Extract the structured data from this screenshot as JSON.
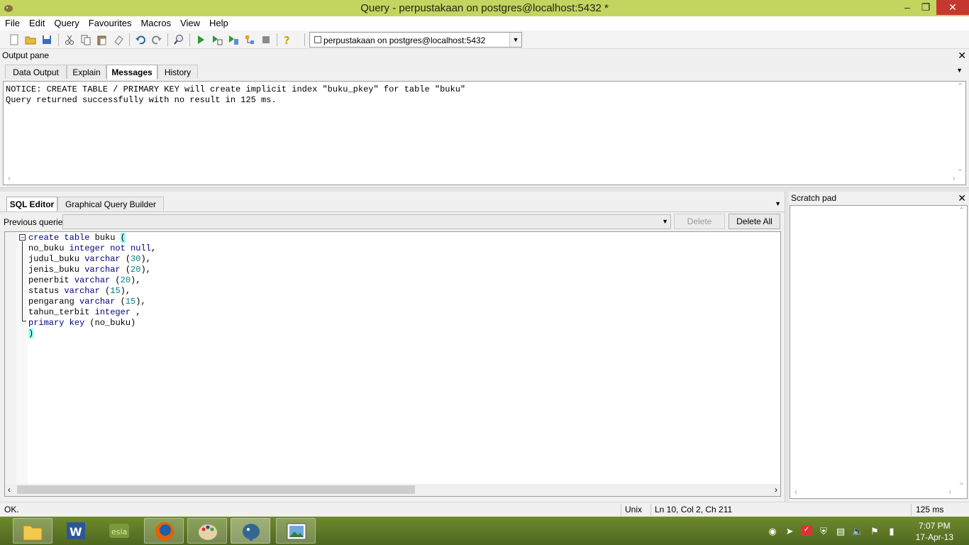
{
  "window": {
    "title": "Query - perpustakaan on postgres@localhost:5432 *"
  },
  "menu": [
    "File",
    "Edit",
    "Query",
    "Favourites",
    "Macros",
    "View",
    "Help"
  ],
  "toolbar": {
    "connection": "perpustakaan on postgres@localhost:5432"
  },
  "output_pane": {
    "title": "Output pane",
    "tabs": [
      "Data Output",
      "Explain",
      "Messages",
      "History"
    ],
    "active_tab": "Messages",
    "messages": [
      "NOTICE:  CREATE TABLE / PRIMARY KEY will create implicit index \"buku_pkey\" for table \"buku\"",
      "Query returned successfully with no result in 125 ms."
    ]
  },
  "editor": {
    "tabs": [
      "SQL Editor",
      "Graphical Query Builder"
    ],
    "active_tab": "SQL Editor",
    "previous_queries_label": "Previous queries",
    "delete_label": "Delete",
    "delete_all_label": "Delete All"
  },
  "scratch_pad": {
    "title": "Scratch pad"
  },
  "status": {
    "message": "OK.",
    "line_endings": "Unix",
    "position": "Ln 10, Col 2, Ch 211",
    "time": "125 ms"
  },
  "taskbar": {
    "time": "7:07 PM",
    "date": "17-Apr-13"
  }
}
